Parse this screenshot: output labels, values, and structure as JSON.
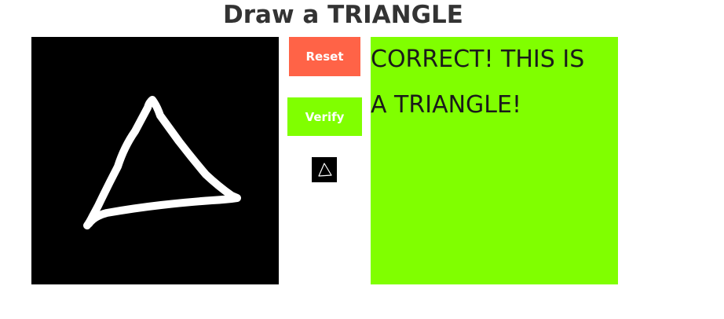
{
  "header": {
    "title": "Draw a TRIANGLE"
  },
  "controls": {
    "reset_label": "Reset",
    "verify_label": "Verify"
  },
  "result": {
    "message": "CORRECT! THIS IS A TRIANGLE!"
  },
  "colors": {
    "reset_bg": "#ff6347",
    "verify_bg": "#80ff00",
    "result_bg": "#80ff00",
    "canvas_bg": "#000000",
    "stroke": "#ffffff"
  },
  "icons": {
    "drawing_canvas": "triangle-sketch",
    "preview": "triangle-thumbnail-icon"
  }
}
